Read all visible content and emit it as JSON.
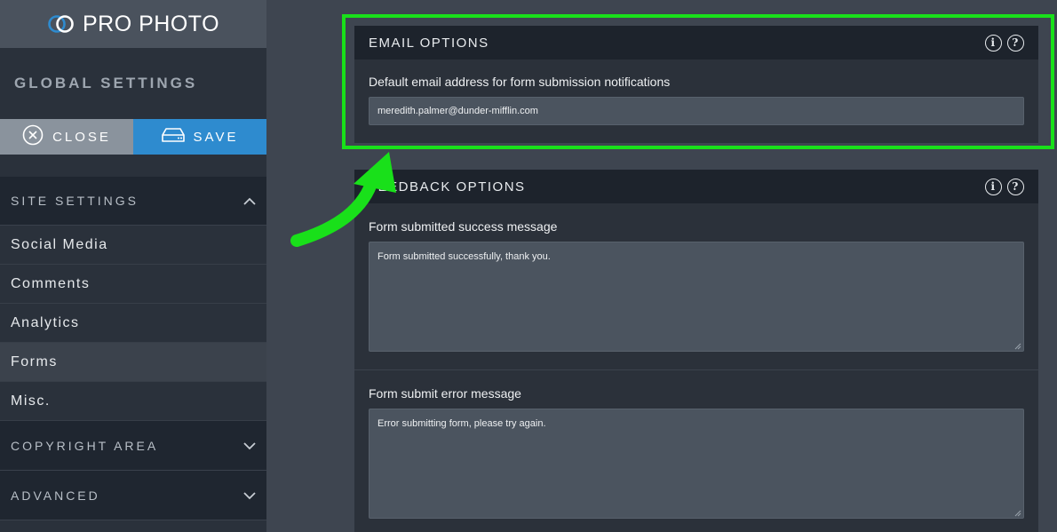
{
  "brand": {
    "name": "PRO PHOTO"
  },
  "sidebar": {
    "title": "GLOBAL SETTINGS",
    "close_label": "CLOSE",
    "save_label": "SAVE",
    "site_settings": {
      "label": "SITE SETTINGS",
      "items": [
        {
          "label": "Social Media"
        },
        {
          "label": "Comments"
        },
        {
          "label": "Analytics"
        },
        {
          "label": "Forms"
        },
        {
          "label": "Misc."
        }
      ]
    },
    "copyright_label": "COPYRIGHT AREA",
    "advanced_label": "ADVANCED"
  },
  "email_options": {
    "title": "EMAIL OPTIONS",
    "field_label": "Default email address for form submission notifications",
    "field_value": "meredith.palmer@dunder-mifflin.com"
  },
  "feedback_options": {
    "title": "FEEDBACK OPTIONS",
    "success_label": "Form submitted success message",
    "success_value": "Form submitted successfully, thank you.",
    "error_label": "Form submit error message",
    "error_value": "Error submitting form, please try again."
  },
  "icons": {
    "info": "i",
    "help": "?"
  },
  "colors": {
    "accent": "#2e8bcf",
    "highlight": "#19e01a"
  }
}
